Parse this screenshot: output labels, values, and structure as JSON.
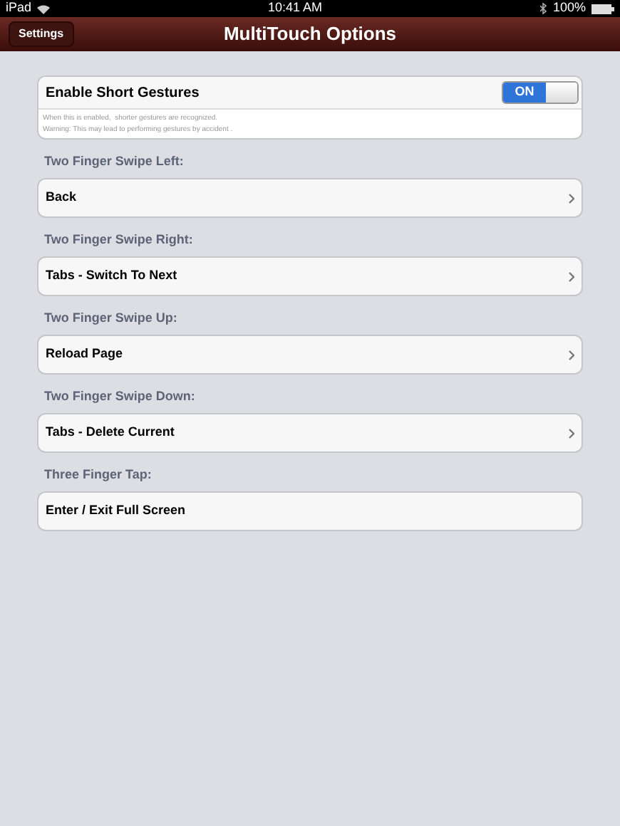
{
  "status_bar": {
    "device": "iPad",
    "time": "10:41 AM",
    "battery": "100%"
  },
  "nav": {
    "back": "Settings",
    "title": "MultiTouch Options"
  },
  "toggle": {
    "label": "Enable Short Gestures",
    "on": true,
    "state_text": "ON",
    "notes": [
      "When this is enabled,  shorter gestures are recognized.",
      "Warning: This may lead to performing gestures by accident ."
    ]
  },
  "sections": [
    {
      "header": "Two Finger Swipe Left:",
      "value": "Back",
      "chevron": true
    },
    {
      "header": "Two Finger Swipe Right:",
      "value": "Tabs - Switch To Next",
      "chevron": true
    },
    {
      "header": "Two Finger Swipe Up:",
      "value": "Reload Page",
      "chevron": true
    },
    {
      "header": "Two Finger Swipe Down:",
      "value": "Tabs - Delete Current",
      "chevron": true
    },
    {
      "header": "Three Finger Tap:",
      "value": "Enter / Exit Full Screen",
      "chevron": false
    }
  ]
}
